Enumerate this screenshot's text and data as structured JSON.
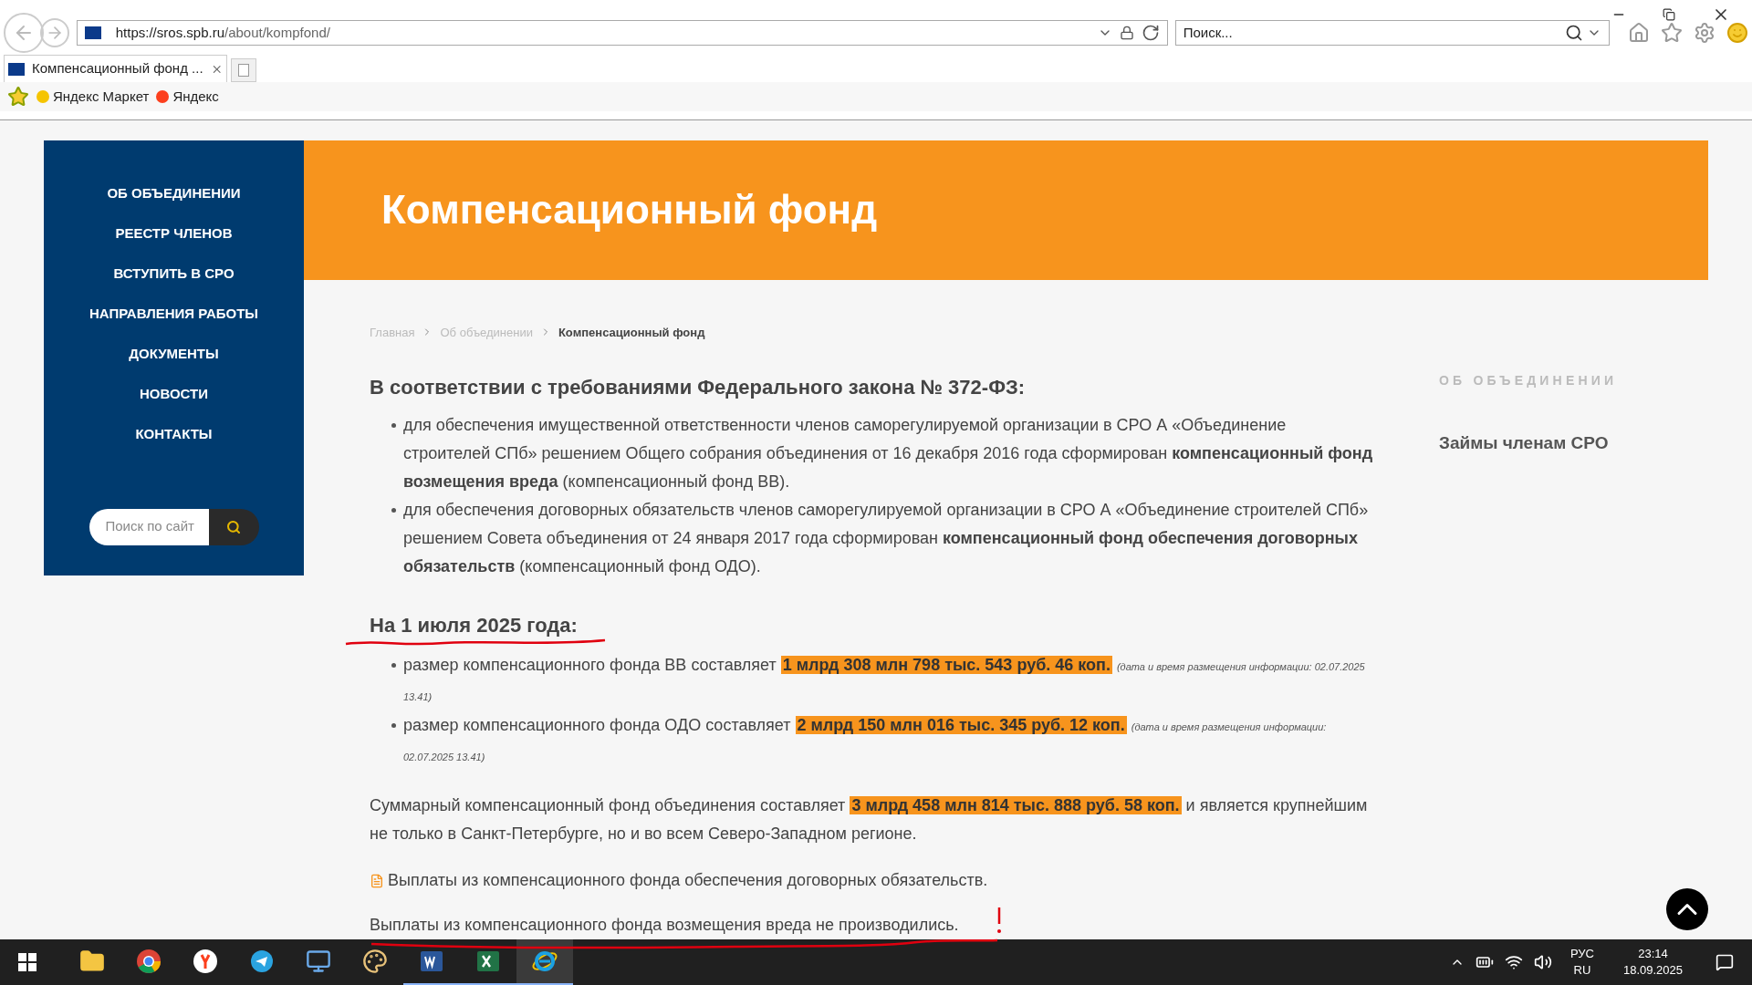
{
  "browser": {
    "url_host": "https://sros.spb.ru",
    "url_path": "/about/kompfond/",
    "search_placeholder": "Поиск...",
    "tab": {
      "title": "Компенсационный фонд ...",
      "selected": true
    },
    "favorites": [
      "Яндекс Маркет",
      "Яндекс"
    ]
  },
  "sidebar": {
    "menu": [
      "ОБ ОБЪЕДИНЕНИИ",
      "РЕЕСТР ЧЛЕНОВ",
      "ВСТУПИТЬ В СРО",
      "НАПРАВЛЕНИЯ РАБОТЫ",
      "ДОКУМЕНТЫ",
      "НОВОСТИ",
      "КОНТАКТЫ"
    ],
    "search_placeholder": "Поиск по сайт"
  },
  "header": {
    "title": "Компенсационный фонд"
  },
  "breadcrumbs": [
    {
      "label": "Главная",
      "current": false
    },
    {
      "label": "Об объединении",
      "current": false
    },
    {
      "label": "Компенсационный фонд",
      "current": true
    }
  ],
  "law_heading": "В соответствии с требованиями Федерального закона № 372-ФЗ:",
  "law_items": [
    "для обеспечения имущественной ответственности членов саморегулируемой организации в СРО А «Объединение строителей СПб» решением Общего собрания объединения от 16 декабря 2016 года  сформирован **компенсационный фонд возмещения вреда** (компенсационный фонд ВВ).",
    "для обеспечения договорных обязательств членов саморегулируемой организации в СРО А «Объединение строителей СПб»  решением Совета объединения от 24 января 2017 года  сформирован **компенсационный фонд обеспечения договорных обязательств** (компенсационный фонд ОДО)."
  ],
  "date_heading": "На 1 июля 2025 года:",
  "fund_items": [
    {
      "text": "размер компенсационного фонда ВВ составляет",
      "amount": "1 млрд 308 млн 798 тыс. 543 руб. 46 коп.",
      "note": "(дата и время размещения информации: 02.07.2025 13.41)"
    },
    {
      "text": "размер компенсационного фонда ОДО составляет",
      "amount": "2 млрд 150 млн 016 тыс. 345 руб. 12 коп.",
      "note": "(дата и время размещения информации: 02.07.2025 13.41)"
    }
  ],
  "total": {
    "before": "Суммарный компенсационный фонд объединения составляет",
    "amount": "3 млрд 458 млн 814 тыс. 888 руб. 58 коп.",
    "after": "и является крупнейшим не только в Санкт-Петербурге, но и во всем Северо-Западном регионе."
  },
  "pdf_link": "Выплаты из компенсационного фонда обеспечения договорных обязательств.",
  "final_note": "Выплаты из компенсационного фонда возмещения вреда не производились.",
  "right_sidebar": {
    "heading": "ОБ ОБЪЕДИНЕНИИ",
    "links": [
      "Займы членам СРО"
    ]
  },
  "taskbar": {
    "apps": [
      {
        "kind": "explorer",
        "running": false,
        "active": false
      },
      {
        "kind": "chrome",
        "running": false,
        "active": false
      },
      {
        "kind": "yandex",
        "running": false,
        "active": false
      },
      {
        "kind": "telegram",
        "running": false,
        "active": false
      },
      {
        "kind": "monitor",
        "running": false,
        "active": false
      },
      {
        "kind": "paint",
        "running": false,
        "active": false
      },
      {
        "kind": "word",
        "running": true,
        "active": false
      },
      {
        "kind": "excel",
        "running": true,
        "active": false
      },
      {
        "kind": "ie",
        "running": true,
        "active": true
      }
    ],
    "language": "РУС",
    "layout": "RU",
    "time": "23:14",
    "date": "18.09.2025"
  }
}
